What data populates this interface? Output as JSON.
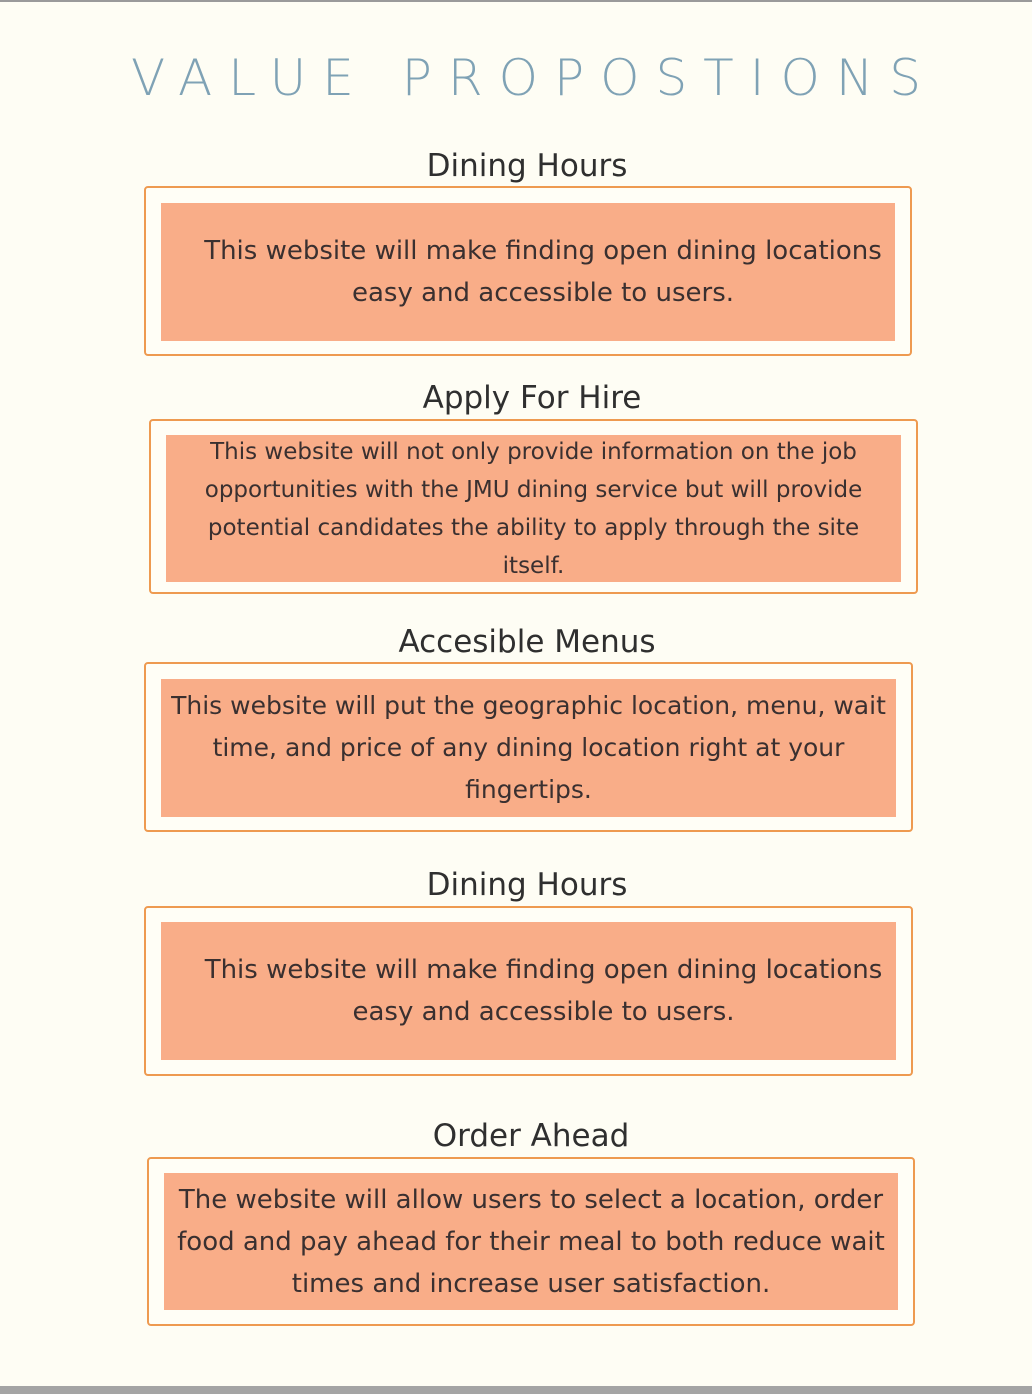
{
  "title": "VALUE PROPOSTIONS",
  "sections": [
    {
      "heading": "Dining Hours",
      "text": "This website will make finding open dining locations easy and accessible to users."
    },
    {
      "heading": "Apply For Hire",
      "text": "This website will not only provide information on the job opportunities with the JMU dining service but will provide potential candidates the ability to apply through the site itself."
    },
    {
      "heading": "Accesible Menus",
      "text": "This website will put the geographic location, menu, wait time, and price of any dining location right at your fingertips."
    },
    {
      "heading": "Dining Hours",
      "text": "This website will make finding open dining locations easy and accessible to users."
    },
    {
      "heading": "Order Ahead",
      "text": "The website will allow users to select a location, order food and pay ahead for their meal to both reduce wait times and increase user satisfaction."
    }
  ],
  "colors": {
    "background": "#fefdf4",
    "title": "#7fa2b5",
    "heading": "#2f2f2f",
    "box_border": "#ee9a50",
    "box_fill": "#f9ad88",
    "body_text": "#3a3030"
  }
}
